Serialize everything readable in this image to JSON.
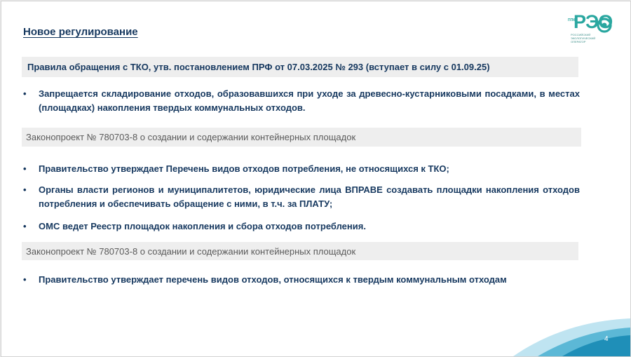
{
  "slide": {
    "title": "Новое регулирование",
    "page_number": "4",
    "logo": {
      "small": "ППК",
      "name": "РЭО",
      "subtitle": "РОССИЙСКИЙ ЭКОЛОГИЧЕСКИЙ ОПЕРАТОР"
    },
    "colors": {
      "accent": "#2aa7a0",
      "text": "#16385f",
      "bar": "#eeeeee"
    }
  },
  "sections": [
    {
      "header": "Правила обращения с ТКО, утв. постановлением ПРФ от 07.03.2025 № 293 (вступает в силу с 01.09.25)",
      "bullets": [
        "Запрещается складирование отходов, образовавшихся при уходе за древесно-кустарниковыми посадками, в местах (площадках) накопления твердых коммунальных отходов."
      ]
    },
    {
      "header": "Законопроект № 780703-8 о создании и содержании контейнерных площадок",
      "bullets": [
        "Правительство утверждает  Перечень видов отходов потребления, не относящихся к ТКО;",
        "Органы власти регионов и муниципалитетов, юридические лица ВПРАВЕ создавать площадки накопления отходов потребления и обеспечивать обращение с ними, в т.ч. за ПЛАТУ;",
        "ОМС ведет Реестр площадок накопления и сбора отходов потребления."
      ]
    },
    {
      "header": "Законопроект № 780703-8 о создании и содержании контейнерных площадок",
      "bullets": [
        "Правительство утверждает перечень видов отходов, относящихся к твердым коммунальным отходам"
      ]
    }
  ],
  "bullet_char": "•"
}
